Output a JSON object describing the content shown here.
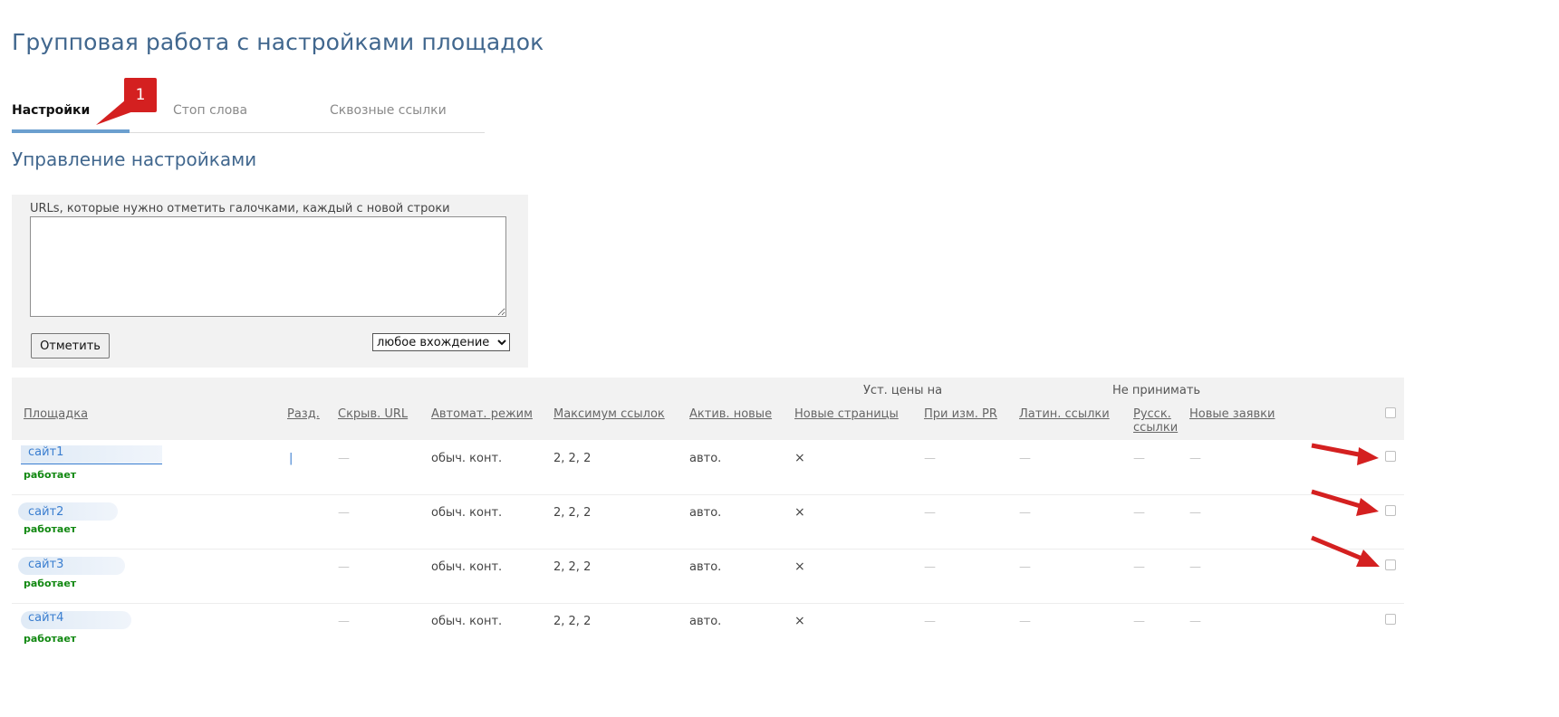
{
  "page": {
    "title": "Групповая работа с настройками площадок"
  },
  "tabs": [
    {
      "label": "Настройки",
      "active": true
    },
    {
      "label": "Стоп слова",
      "active": false
    },
    {
      "label": "Сквозные ссылки",
      "active": false
    }
  ],
  "annotation": {
    "badge": "1",
    "color": "#d42020"
  },
  "section": {
    "title": "Управление настройками"
  },
  "form": {
    "label": "URLs, которые нужно отметить галочками, каждый с новой строки",
    "textarea_value": "",
    "button_label": "Отметить",
    "select_value": "любое вхождение",
    "select_options": [
      "любое вхождение"
    ]
  },
  "table": {
    "group_labels": [
      "Уст. цены на",
      "Не принимать"
    ],
    "columns": [
      "Площадка",
      "Разд.",
      "Скрыв. URL",
      "Автомат. режим",
      "Максимум ссылок",
      "Актив. новые",
      "Новые страницы",
      "При изм. PR",
      "Латин. ссылки",
      "Русск. ссылки",
      "Новые заявки"
    ],
    "rows": [
      {
        "site": "сайт1",
        "status": "работает",
        "razd": "|",
        "hidden_url": "—",
        "auto_mode": "обыч. конт.",
        "max_links": "2, 2, 2",
        "active_new": "авто.",
        "new_pages": "×",
        "on_pr": "—",
        "latin": "—",
        "russian": "—",
        "new_requests": "—"
      },
      {
        "site": "сайт2",
        "status": "работает",
        "razd": "",
        "hidden_url": "—",
        "auto_mode": "обыч. конт.",
        "max_links": "2, 2, 2",
        "active_new": "авто.",
        "new_pages": "×",
        "on_pr": "—",
        "latin": "—",
        "russian": "—",
        "new_requests": "—"
      },
      {
        "site": "сайт3",
        "status": "работает",
        "razd": "",
        "hidden_url": "—",
        "auto_mode": "обыч. конт.",
        "max_links": "2, 2, 2",
        "active_new": "авто.",
        "new_pages": "×",
        "on_pr": "—",
        "latin": "—",
        "russian": "—",
        "new_requests": "—"
      },
      {
        "site": "сайт4",
        "status": "работает",
        "razd": "",
        "hidden_url": "—",
        "auto_mode": "обыч. конт.",
        "max_links": "2, 2, 2",
        "active_new": "авто.",
        "new_pages": "×",
        "on_pr": "—",
        "latin": "—",
        "russian": "—",
        "new_requests": "—"
      }
    ]
  },
  "colors": {
    "accent": "#41678e",
    "link": "#3a7ed0",
    "status_ok": "#118811",
    "arrow": "#d42020"
  }
}
